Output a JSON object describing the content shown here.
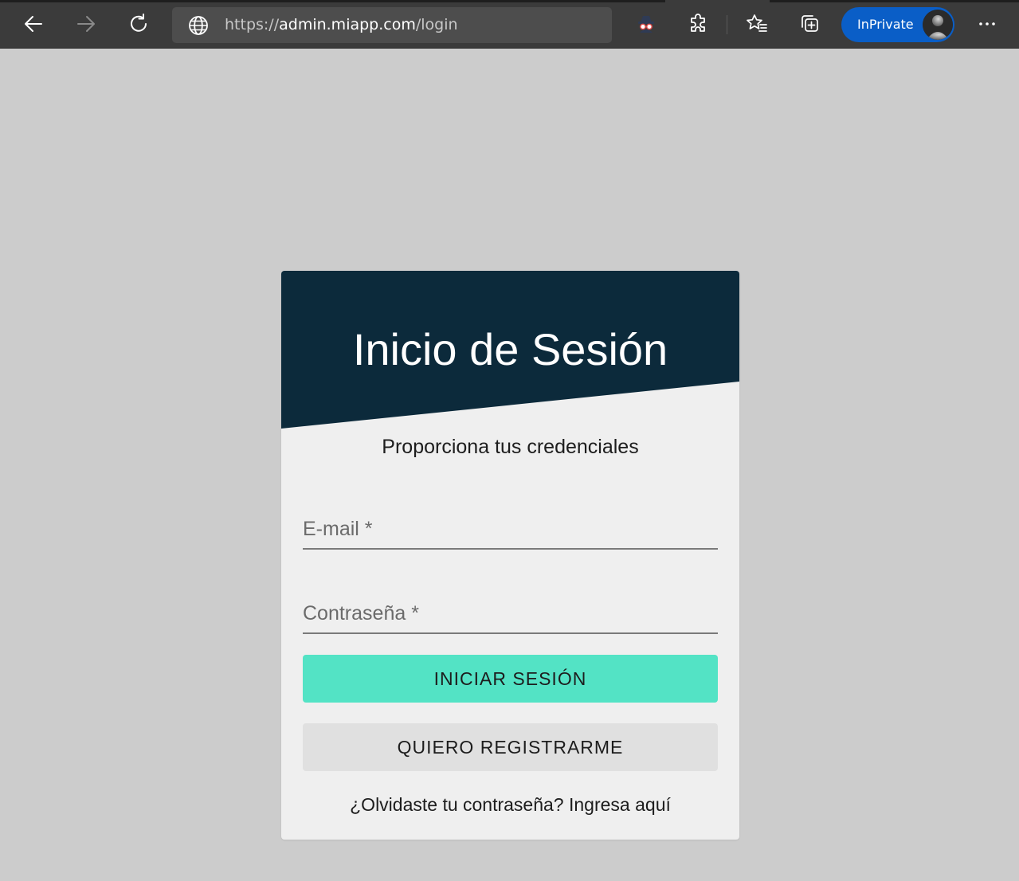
{
  "browser": {
    "url_scheme": "https://",
    "url_host": "admin.miapp.com",
    "url_path": "/login",
    "inprivate_label": "InPrivate",
    "icons": {
      "back": "arrow-left-icon",
      "forward": "arrow-right-icon",
      "reload": "reload-icon",
      "site_info": "globe-icon",
      "tracking": "incognito-icon",
      "extensions": "puzzle-icon",
      "favorites": "favorites-star-icon",
      "collections": "collections-icon",
      "menu": "more-dots-icon"
    },
    "colors": {
      "toolbar": "#3b3b3b",
      "address_bar": "#4d4d4d",
      "inprivate_pill": "#0a5ec7"
    }
  },
  "login": {
    "title": "Inicio de Sesión",
    "subtitle": "Proporciona tus credenciales",
    "email_label": "E-mail *",
    "password_label": "Contraseña *",
    "login_button": "INICIAR SESIÓN",
    "register_button": "QUIERO REGISTRARME",
    "forgot_question": "¿Olvidaste tu contraseña?",
    "forgot_link": "Ingresa aquí",
    "colors": {
      "page_background": "#cccccc",
      "card_background": "#efefef",
      "header": "#0c2a3b",
      "primary_button": "#53e3c5",
      "secondary_button": "#e0e0e0"
    }
  }
}
